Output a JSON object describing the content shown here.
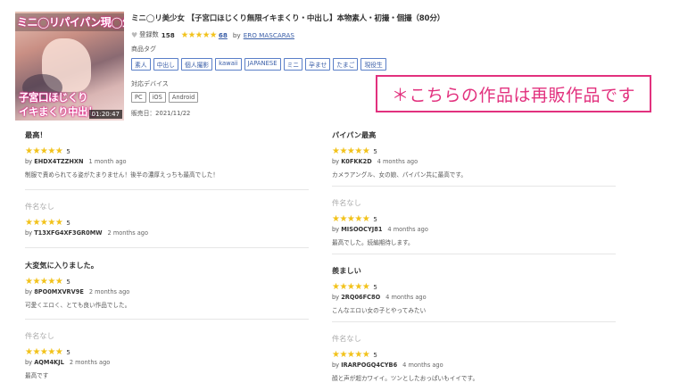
{
  "product": {
    "thumbnail": {
      "overlay_top": "ミニ◯リパイパン現◯生",
      "overlay_line1": "子宮口ほじくり",
      "overlay_line2": "イキまくり中出し",
      "duration": "01:20:47"
    },
    "title": "ミニ◯リ美少女 【子宮口ほじくり無限イキまくり・中出し】本物素人・初撮・個撮（80分）",
    "favorites_label": "登録数",
    "favorites_count": "158",
    "rating_stars": "★★★★★",
    "rating_count": "68",
    "by_label": "by",
    "maker": "ERO MASCARAS",
    "tags_label": "商品タグ",
    "tags": [
      "素人",
      "中出し",
      "個人撮影",
      "kawaii",
      "JAPANESE",
      "ミニ",
      "孕ませ",
      "たまご",
      "現役生"
    ],
    "devices_label": "対応デバイス",
    "devices": [
      "PC",
      "iOS",
      "Android"
    ],
    "release": "販売日：2021/11/22"
  },
  "resale_notice": "＊こちらの作品は再販作品です",
  "reviews": [
    {
      "title": "最高！",
      "stars": "★★★★★",
      "score": "5",
      "user": "EHDX4TZZHXN",
      "ago": "1 month ago",
      "body": "制服で責められてる姿がたまりません！後半の濃厚えっちも最高でした！"
    },
    {
      "title": "パイパン最高",
      "stars": "★★★★★",
      "score": "5",
      "user": "K0FKK2D",
      "ago": "4 months ago",
      "body": "カメラアングル、女の娘、パイパン共に最高です。"
    },
    {
      "title": "件名なし",
      "stars": "★★★★★",
      "score": "5",
      "user": "T13XFG4XF3GR0MW",
      "ago": "2 months ago",
      "body": ""
    },
    {
      "title": "件名なし",
      "stars": "★★★★★",
      "score": "5",
      "user": "MISOOCYJ81",
      "ago": "4 months ago",
      "body": "最高でした。続編期待します。"
    },
    {
      "title": "大変気に入りました。",
      "stars": "★★★★★",
      "score": "5",
      "user": "8PO0MXVRV9E",
      "ago": "2 months ago",
      "body": "可愛くエロく、とても良い作品でした。"
    },
    {
      "title": "羨ましい",
      "stars": "★★★★★",
      "score": "5",
      "user": "2RQ06FC8O",
      "ago": "4 months ago",
      "body": "こんなエロい女の子とやってみたい"
    },
    {
      "title": "件名なし",
      "stars": "★★★★★",
      "score": "5",
      "user": "AQM4KJL",
      "ago": "2 months ago",
      "body": "最高です"
    },
    {
      "title": "件名なし",
      "stars": "★★★★★",
      "score": "5",
      "user": "IRARPOGQ4CYB6",
      "ago": "4 months ago",
      "body": "顔と声が超カワイイ。ツンとしたおっぱいもイイです。"
    }
  ]
}
